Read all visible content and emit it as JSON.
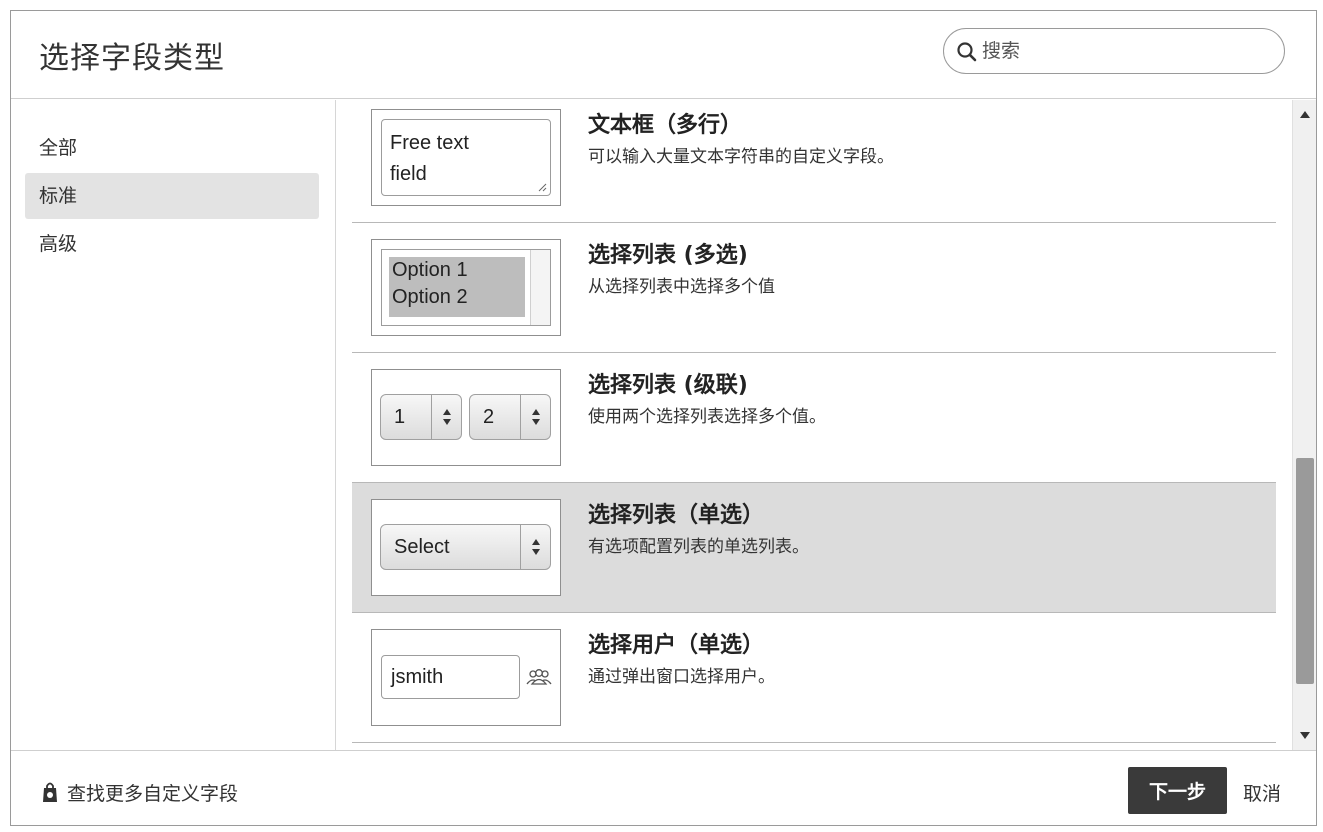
{
  "dialog": {
    "title": "选择字段类型"
  },
  "search": {
    "placeholder": "搜索",
    "value": ""
  },
  "sidebar": {
    "items": [
      {
        "label": "全部",
        "active": false
      },
      {
        "label": "标准",
        "active": true
      },
      {
        "label": "高级",
        "active": false
      }
    ]
  },
  "fields": [
    {
      "name": "文本框（多行）",
      "desc": "可以输入大量文本字符串的自定义字段。",
      "preview": {
        "line1": "Free text",
        "line2": "field"
      }
    },
    {
      "name": "选择列表 (多选)",
      "desc": "从选择列表中选择多个值",
      "preview": {
        "option1": "Option 1",
        "option2": "Option 2"
      }
    },
    {
      "name": "选择列表 (级联)",
      "desc": "使用两个选择列表选择多个值。",
      "preview": {
        "first": "1",
        "second": "2"
      }
    },
    {
      "name": "选择列表（单选）",
      "desc": "有选项配置列表的单选列表。",
      "selected": true,
      "preview": {
        "value": "Select"
      }
    },
    {
      "name": "选择用户（单选）",
      "desc": "通过弹出窗口选择用户。",
      "preview": {
        "value": "jsmith"
      }
    }
  ],
  "footer": {
    "more_link": "查找更多自定义字段",
    "next_label": "下一步",
    "cancel_label": "取消"
  },
  "icons": {
    "search": "search-icon",
    "users": "users-icon",
    "shopping_bag": "shopping-bag-icon",
    "resize": "resize-grip-icon"
  },
  "colors": {
    "selected_row": "#dcdcdc",
    "active_sidebar": "#e3e3e3",
    "primary_button": "#3a3a3a"
  }
}
